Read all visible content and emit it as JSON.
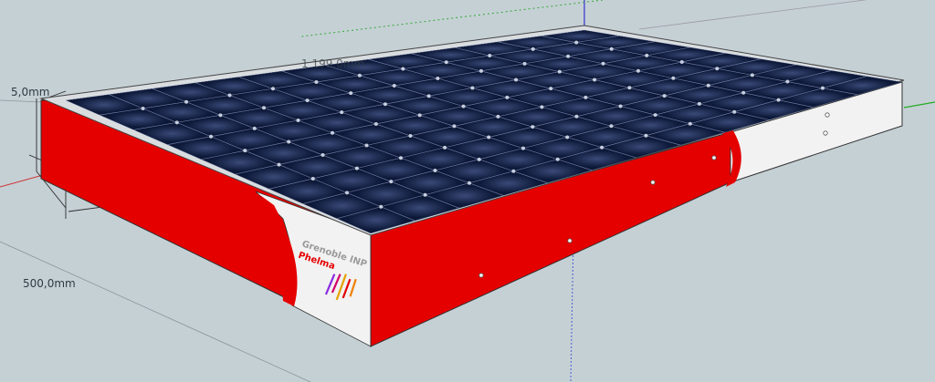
{
  "window": {
    "title": ""
  },
  "dimensions": {
    "thickness_label": "5,0mm",
    "top_edge_label": "1 199,0mm",
    "depth_label": "500,0mm"
  },
  "logo": {
    "line1": "Grenoble INP",
    "line2": "Phelma"
  },
  "colors": {
    "background": "#c5d0d5",
    "case_red": "#e50000",
    "case_white": "#f2f2f2",
    "panel_dark": "#0f1a33",
    "axis_red": "#d11",
    "axis_green": "#2a2",
    "axis_blue": "#22c"
  },
  "icons": {
    "grid": "solar-cell-grid",
    "axes": "xyz-axes"
  }
}
